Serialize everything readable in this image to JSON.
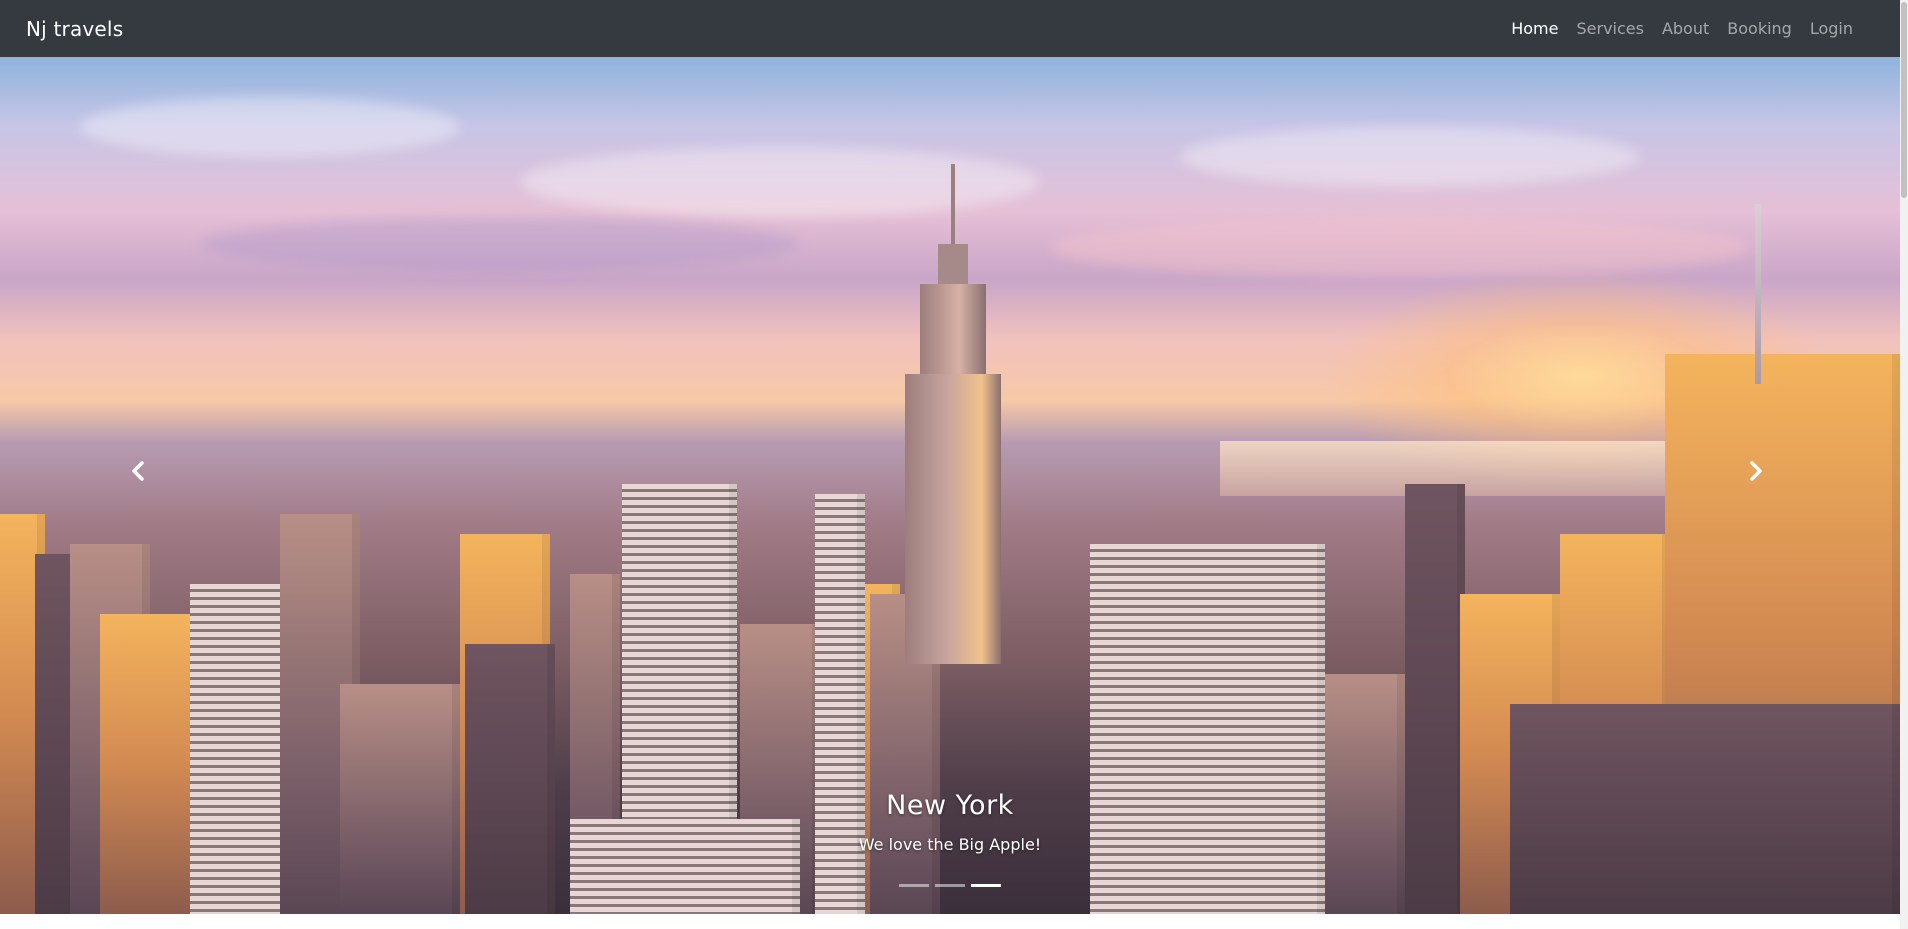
{
  "navbar": {
    "brand": "Nj travels",
    "links": [
      {
        "label": "Home",
        "active": true
      },
      {
        "label": "Services",
        "active": false
      },
      {
        "label": "About",
        "active": false
      },
      {
        "label": "Booking",
        "active": false
      },
      {
        "label": "Login",
        "active": false
      }
    ],
    "background_color": "#343a40"
  },
  "carousel": {
    "slide": {
      "title": "New York",
      "text": "We love the Big Apple!"
    },
    "controls": {
      "prev_icon": "chevron-left-icon",
      "next_icon": "chevron-right-icon"
    },
    "indicators": {
      "count": 3,
      "active_index": 2
    }
  }
}
